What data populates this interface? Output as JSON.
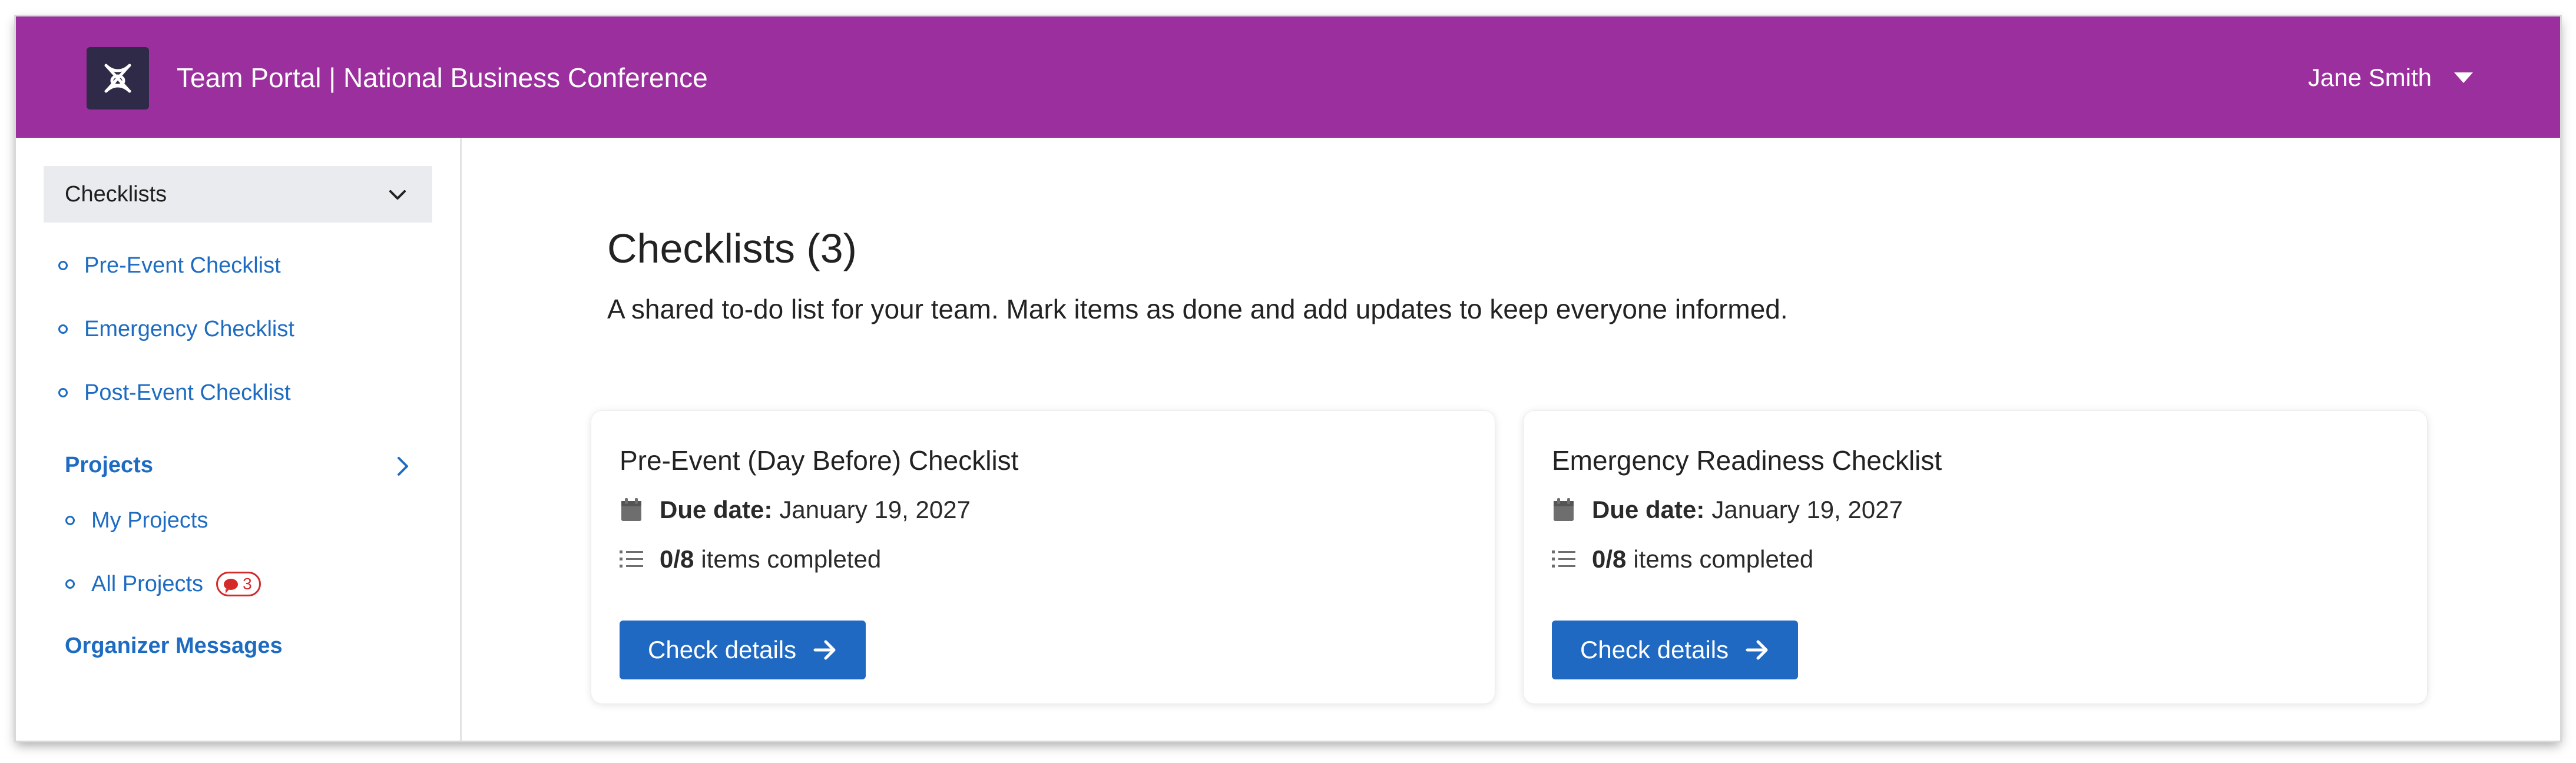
{
  "header": {
    "title": "Team Portal | National Business Conference",
    "user_name": "Jane Smith",
    "logo_icon": "knot-logo-icon",
    "colors": {
      "bar": "#9b2f9e",
      "logo_bg": "#2e2a48"
    }
  },
  "sidebar": {
    "section_header": "Checklists",
    "checklist_items": [
      {
        "label": "Pre-Event Checklist"
      },
      {
        "label": "Emergency Checklist"
      },
      {
        "label": "Post-Event Checklist"
      }
    ],
    "projects_label": "Projects",
    "project_items": [
      {
        "label": "My Projects"
      },
      {
        "label": "All Projects",
        "badge_count": "3"
      }
    ],
    "organizer_messages_label": "Organizer Messages",
    "colors": {
      "link": "#1e6cc2",
      "badge": "#d42a2a",
      "header_bg": "#e9ebee"
    }
  },
  "main": {
    "title": "Checklists (3)",
    "description": "A shared to-do list for your team. Mark items as done and add updates to keep everyone informed.",
    "cards": [
      {
        "title": "Pre-Event (Day Before) Checklist",
        "due_label": "Due date:",
        "due_value": "January 19, 2027",
        "progress_count": "0/8",
        "progress_text": "items completed",
        "button_label": "Check details"
      },
      {
        "title": "Emergency Readiness Checklist",
        "due_label": "Due date:",
        "due_value": "January 19, 2027",
        "progress_count": "0/8",
        "progress_text": "items completed",
        "button_label": "Check details"
      }
    ],
    "colors": {
      "button": "#1f69c3"
    }
  }
}
